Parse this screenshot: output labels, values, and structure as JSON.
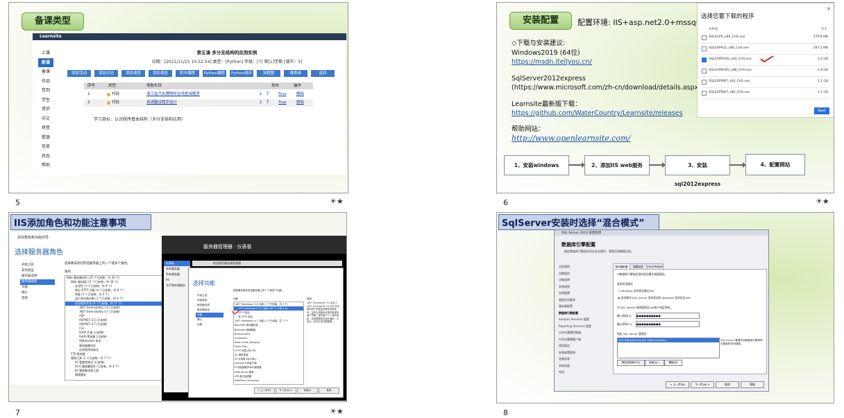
{
  "slides": {
    "s5": {
      "number": "5",
      "title": "备课类型",
      "site": "Learnsite",
      "sidebar": [
        "上课",
        "新课",
        "备课",
        "作品",
        "签到",
        "学生",
        "常识",
        "中文",
        "拼音",
        "提源",
        "信息",
        "状态",
        "帮助"
      ],
      "lesson_title": "第五课 多分支结构的应用实例",
      "lesson_meta": "日期：[2021/11/15 10:52:54] 类型：[Python] 年级：[7] 第[1]学期 [课节：5]",
      "buttons": [
        "添加活动",
        "添加讨论",
        "添加调查",
        "添加调查",
        "积木编程",
        "Python编程",
        "Python测评",
        "流程图",
        "微表单",
        "返回"
      ],
      "table_headers": [
        "序号",
        "类型",
        "导航栏目",
        "发布",
        "操作"
      ],
      "rows": [
        {
          "n": "1",
          "type": "代码",
          "title": "浙江省汽车牌照所在地查询程序",
          "up": "上",
          "down": "下",
          "pub": "True",
          "op": "删除"
        },
        {
          "n": "2",
          "type": "代码",
          "title": "英语翻译程序设计",
          "up": "上",
          "down": "下",
          "pub": "True",
          "op": "删除"
        }
      ],
      "goal": "学习目标：认识程序基本结构（多分支结构应用）"
    },
    "s6": {
      "number": "6",
      "title": "安装配置",
      "env": "配置环境: IIS+asp.net2.0+mssql",
      "downloads_label": "◇下载与安装建议:",
      "os_line": "Windows2019 (64位)",
      "msdn_link": "https://msdn.itellyou.cn/",
      "sql_label": "SqlServer2012express",
      "sql_link": "(https://www.microsoft.com/zh-cn/download/details.aspx?id=433",
      "ls_label": "Learnsite最新版下载：",
      "ls_link": "https://github.com/WaterCountry/Learnsite/releases",
      "help_label": "帮助网站：",
      "help_link": "http://www.openlearnsite.com/",
      "dialog_title": "选择您要下载的程序",
      "dialog_col_name": "文件名",
      "dialog_col_size": "大小",
      "dialog_rows": [
        {
          "name": "SQLEXPR_x86_CHS.exe",
          "size": "279.8 MB",
          "checked": false
        },
        {
          "name": "SQLEXPR32_x86_CHS.exe",
          "size": "267.5 MB",
          "checked": false
        },
        {
          "name": "SQLEXPRADV_x64_CHS.exe",
          "size": "1.0 GB",
          "checked": true
        },
        {
          "name": "SQLEXPRADV_x86_CHS.exe",
          "size": "1.9 GB",
          "checked": false
        },
        {
          "name": "SQLEXPRWT_x64_CHS.exe",
          "size": "1.1 GB",
          "checked": false
        },
        {
          "name": "SQLEXPRWT_x86_CHS.exe",
          "size": "1.1 GB",
          "checked": false
        }
      ],
      "dialog_next": "Next",
      "steps": [
        "1、安装windows",
        "2、添加IIS web服务",
        "3、安装sql2012express",
        "4、配置网站"
      ]
    },
    "s7": {
      "number": "7",
      "title": "IIS添加角色和功能注意事项",
      "wizard_header": "添加角色和功能向导",
      "heading": "选择服务器角色",
      "nav": [
        "开始之前",
        "安装类型",
        "服务器选择",
        "服务器角色",
        "功能",
        "确认",
        "结果"
      ],
      "instr": "选择要安装在所选服务器上的一个或多个角色。",
      "roles_label": "角色",
      "roles": [
        "Web 服务器(IIS) (15 个已安装，共 43 个)",
        "Web 服务器 (11 个已安装，共 34 个)",
        "安全性 (1 个已安装，共 9 个)",
        "常见 HTTP 功能 (4 个已安装，共 6 个)",
        "性能 (1 个已安装，共 2 个)",
        "运行状况和诊断 (1 个已安装，共 6 个)",
        "应用程序开发 (6 个已安装，共 11 个)",
        ".NET Extensibility 3.5 (已安装)",
        ".NET Extensibility 4.7 (已安装)",
        "ASP",
        "ASP.NET 3.5 (已安装)",
        "ASP.NET 4.7 (已安装)",
        "CGI",
        "ISAPI 扩展 (已安装)",
        "ISAPI 筛选器 (已安装)",
        "WebSocket 协议",
        "服务器端包含",
        "应用程序初始化",
        "FTP 服务器",
        "管理工具 (2 个已安装，共 7 个)",
        "IIS 管理控制台 (已安装)",
        "IIS 6 管理兼容性 (已安装，共 4 个)",
        "IIS 管理脚本和工具",
        "管理服务"
      ],
      "server_manager_title": "服务器管理器 · 仪表板",
      "sm_nav": [
        "仪表板",
        "本地服务器",
        "所有服务器",
        "IIS",
        "文件和存储服务"
      ],
      "sm_welcome": "欢迎使用服务器管理器",
      "func_heading": "选择功能",
      "func_nav": [
        "开始之前",
        "安装类型",
        "服务器选择",
        "服务器角色",
        "功能",
        "确认",
        "结果"
      ],
      "func_instr": "选择要安装在所选服务器上的一个或多个功能。",
      "func_label": "功能",
      "features": [
        ".NET Framework 3.5 功能 (1 个已安装，共 3 个)",
        ".NET Framework 3.5 (包括 .NET 2.0 和 3.0)",
        "HTTP 激活",
        "非 HTTP 激活",
        ".NET Framework 4.7 功能 (2 个已安装，共 7 个)",
        "BitLocker 驱动器加密",
        "BitLocker 网络解锁",
        "BranchCache",
        "Containers",
        "Data Center Bridging",
        "Direct Play",
        "HTTP 代理上的 RPC",
        "I/O 服务质量",
        "IIS 可承载 Web 核心",
        "Internet 打印客户端",
        "IP 地址管理(IPAM)服务器",
        "iSNS Server 服务",
        "LPR 端口监视器",
        "MultiPoint Connector"
      ],
      "func_desc_label": "描述",
      "func_desc": ".NET Framework 3.5 结合了 .NET Framework 2.0 API 的功能和用于构建应用程序的新技术，这些应用程序可提供美观的用户界面，保护客户个人身份信息，实现顺畅而安全的通信，以及为一系列业务流程建模。",
      "func_buttons": [
        "< 上一步(P)",
        "下一步(N) >",
        "安装(I)",
        "取消"
      ]
    },
    "s8": {
      "number": "8",
      "title": "SqlServer安装时选择“混合模式”",
      "window_title": "SQL Server 2012 安装程序",
      "heading": "数据库引擎配置",
      "sub": "指定数据库引擎身份验证安全模式、管理员和数据目录。",
      "nav": [
        "全局规则",
        "设置角色",
        "功能选择",
        "安装规则",
        "实例配置",
        "磁盘空间要求",
        "服务器配置",
        "数据库引擎配置",
        "Analysis Services 配置",
        "Reporting Services 配置",
        "分布式重播控制器",
        "分布式重播客户端",
        "错误报告",
        "安装配置规则",
        "准备安装",
        "安装进度",
        "完成"
      ],
      "tabs": [
        "服务器配置",
        "数据目录",
        "FILESTREAM"
      ],
      "auth_hint": "为数据库引擎指定身份验证模式和管理员。",
      "auth_mode": "身份验证模式",
      "opt_windows": "Windows 身份验证模式(W)",
      "opt_mixed": "混合模式(SQL Server 身份验证和 Windows 身份验证)(M)",
      "sa_label": "为 SQL Server 系统管理员(sa)帐户指定密码。",
      "pwd_label": "输入密码(E):",
      "pwd_confirm": "确认密码(O):",
      "pwd_mask": "●●●●●●●●●●",
      "admin_label": "指定 SQL Server 管理员",
      "admin_user": "XSH-DW\\Administrator (Administrator)",
      "admin_note": "SQL Server 管理员对数据库引擎具有无限制的访问权限。",
      "admin_buttons": [
        "添加当前用户(C)",
        "添加(A)...",
        "删除(R)"
      ],
      "footer_buttons": [
        "< 上一步(B)",
        "下一步(N) >",
        "取消",
        "帮助"
      ]
    }
  }
}
